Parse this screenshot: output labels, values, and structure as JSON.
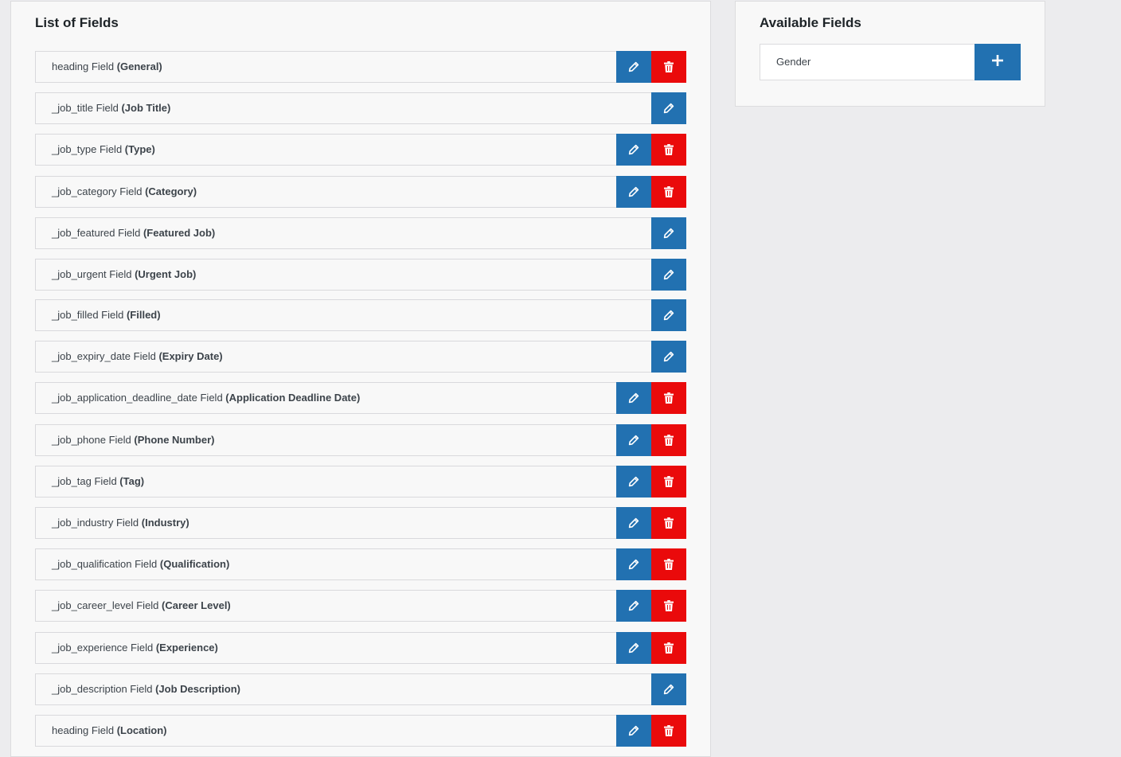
{
  "list_panel": {
    "title": "List of Fields",
    "fields": [
      {
        "name": "heading Field",
        "label": "(General)",
        "deletable": true
      },
      {
        "name": "_job_title Field",
        "label": "(Job Title)",
        "deletable": false
      },
      {
        "name": "_job_type Field",
        "label": "(Type)",
        "deletable": true
      },
      {
        "name": "_job_category Field",
        "label": "(Category)",
        "deletable": true
      },
      {
        "name": "_job_featured Field",
        "label": "(Featured Job)",
        "deletable": false
      },
      {
        "name": "_job_urgent Field",
        "label": "(Urgent Job)",
        "deletable": false
      },
      {
        "name": "_job_filled Field",
        "label": "(Filled)",
        "deletable": false
      },
      {
        "name": "_job_expiry_date Field",
        "label": "(Expiry Date)",
        "deletable": false
      },
      {
        "name": "_job_application_deadline_date Field",
        "label": "(Application Deadline Date)",
        "deletable": true
      },
      {
        "name": "_job_phone Field",
        "label": "(Phone Number)",
        "deletable": true
      },
      {
        "name": "_job_tag Field",
        "label": "(Tag)",
        "deletable": true
      },
      {
        "name": "_job_industry Field",
        "label": "(Industry)",
        "deletable": true
      },
      {
        "name": "_job_qualification Field",
        "label": "(Qualification)",
        "deletable": true
      },
      {
        "name": "_job_career_level Field",
        "label": "(Career Level)",
        "deletable": true
      },
      {
        "name": "_job_experience Field",
        "label": "(Experience)",
        "deletable": true
      },
      {
        "name": "_job_description Field",
        "label": "(Job Description)",
        "deletable": false
      },
      {
        "name": "heading Field",
        "label": "(Location)",
        "deletable": true
      }
    ]
  },
  "available_panel": {
    "title": "Available Fields",
    "items": [
      {
        "label": "Gender"
      }
    ]
  },
  "icons": {
    "edit": "pencil-icon",
    "delete": "trash-icon",
    "add": "plus-icon"
  },
  "colors": {
    "edit_button": "#2271b1",
    "delete_button": "#ea0a0b",
    "add_button": "#2271b1",
    "background": "#ececee",
    "panel": "#f8f8f8"
  }
}
